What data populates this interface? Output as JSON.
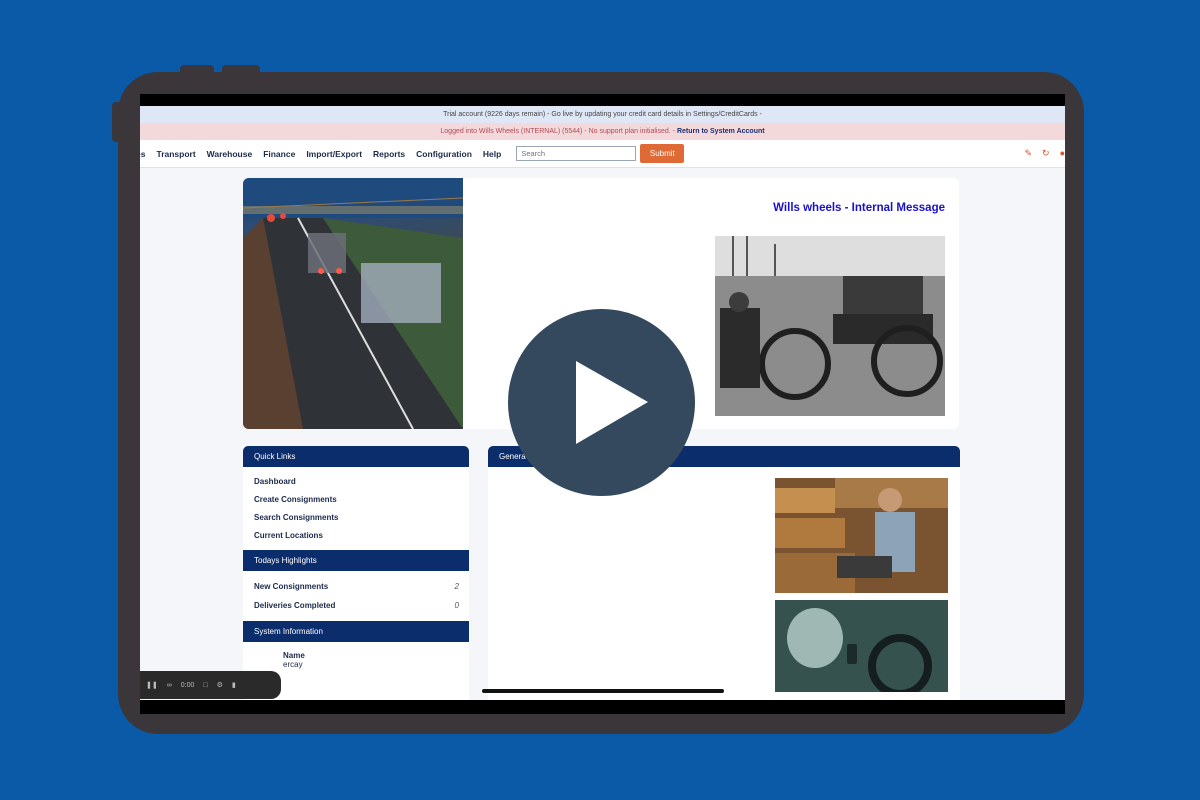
{
  "banner": {
    "trial": "Trial account (9226 days remain) - Go live by updating your credit card details in Settings/CreditCards -",
    "login_prefix": "Logged into Wills Wheels (INTERNAL) (5544) - No support plan initialised. -",
    "return_link": "Return to System Account"
  },
  "nav": {
    "items": [
      "es",
      "Transport",
      "Warehouse",
      "Finance",
      "Import/Export",
      "Reports",
      "Configuration",
      "Help"
    ],
    "search_placeholder": "Search",
    "submit_label": "Submit"
  },
  "hero": {
    "title": "Wills wheels - Internal Message"
  },
  "quick_links": {
    "title": "Quick Links",
    "items": [
      "Dashboard",
      "Create Consignments",
      "Search Consignments",
      "Current Locations"
    ]
  },
  "highlights": {
    "title": "Todays Highlights",
    "rows": [
      {
        "label": "New Consignments",
        "count": "2"
      },
      {
        "label": "Deliveries Completed",
        "count": "0"
      }
    ]
  },
  "system_info": {
    "title": "System Information",
    "name_label": "Name",
    "name_value": "ercay"
  },
  "general_panel": {
    "title": "Genera"
  },
  "video": {
    "time": "0:00"
  },
  "colors": {
    "background": "#0a5aa8",
    "navy": "#0c2d6b",
    "accent": "#e06a36",
    "title_blue": "#1a10c9"
  }
}
